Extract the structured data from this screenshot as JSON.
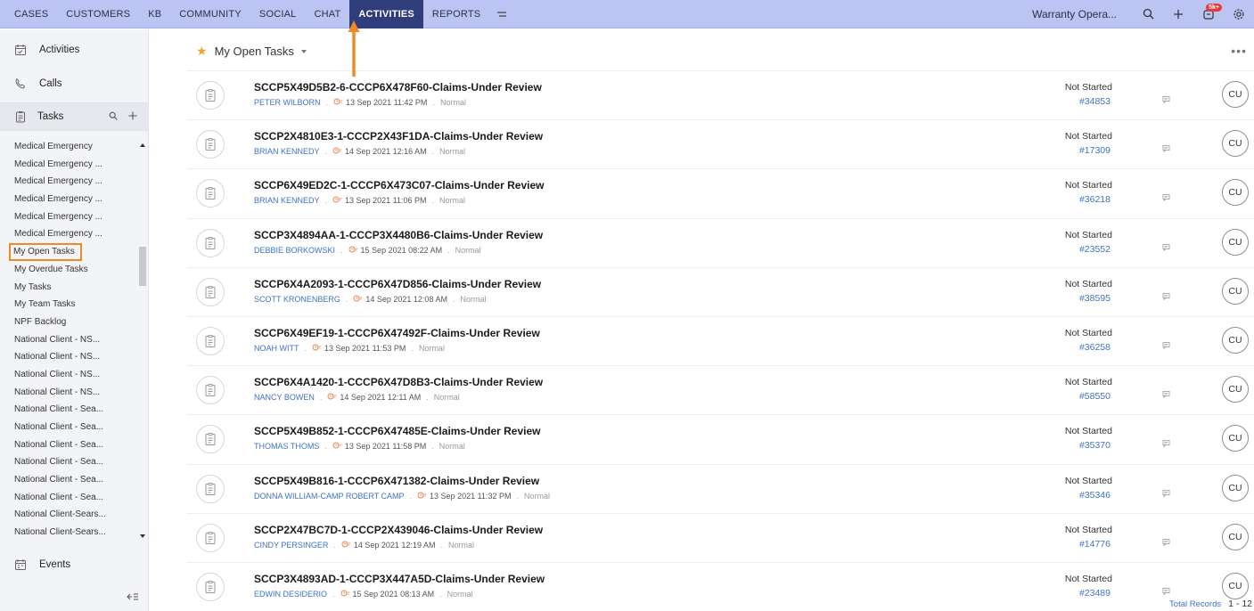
{
  "nav": {
    "items": [
      "CASES",
      "CUSTOMERS",
      "KB",
      "COMMUNITY",
      "SOCIAL",
      "CHAT",
      "ACTIVITIES",
      "REPORTS"
    ],
    "active": "ACTIVITIES",
    "department": "Warranty Opera...",
    "notification_badge": "5k+"
  },
  "sidebar": {
    "modules": {
      "activities": "Activities",
      "calls": "Calls",
      "tasks": "Tasks",
      "events": "Events"
    },
    "views": [
      "Medical Emergency",
      "Medical Emergency ...",
      "Medical Emergency ...",
      "Medical Emergency ...",
      "Medical Emergency ...",
      "Medical Emergency ...",
      "My Open Tasks",
      "My Overdue Tasks",
      "My Tasks",
      "My Team Tasks",
      "NPF Backlog",
      "National Client - NS...",
      "National Client - NS...",
      "National Client - NS...",
      "National Client - NS...",
      "National Client - Sea...",
      "National Client - Sea...",
      "National Client - Sea...",
      "National Client - Sea...",
      "National Client - Sea...",
      "National Client - Sea...",
      "National Client-Sears...",
      "National Client-Sears..."
    ],
    "selected_view": "My Open Tasks"
  },
  "main": {
    "view_title": "My Open Tasks",
    "rows": [
      {
        "subject": "SCCP5X49D5B2-6-CCCP6X478F60-Claims-Under Review",
        "contact": "PETER WILBORN",
        "due": "13 Sep 2021 11:42 PM",
        "priority": "Normal",
        "status": "Not Started",
        "ticket": "#34853",
        "owner": "CU"
      },
      {
        "subject": "SCCP2X4810E3-1-CCCP2X43F1DA-Claims-Under Review",
        "contact": "BRIAN KENNEDY",
        "due": "14 Sep 2021 12:16 AM",
        "priority": "Normal",
        "status": "Not Started",
        "ticket": "#17309",
        "owner": "CU"
      },
      {
        "subject": "SCCP6X49ED2C-1-CCCP6X473C07-Claims-Under Review",
        "contact": "BRIAN KENNEDY",
        "due": "13 Sep 2021 11:06 PM",
        "priority": "Normal",
        "status": "Not Started",
        "ticket": "#36218",
        "owner": "CU"
      },
      {
        "subject": "SCCP3X4894AA-1-CCCP3X4480B6-Claims-Under Review",
        "contact": "DEBBIE BORKOWSKI",
        "due": "15 Sep 2021 08:22 AM",
        "priority": "Normal",
        "status": "Not Started",
        "ticket": "#23552",
        "owner": "CU"
      },
      {
        "subject": "SCCP6X4A2093-1-CCCP6X47D856-Claims-Under Review",
        "contact": "SCOTT KRONENBERG",
        "due": "14 Sep 2021 12:08 AM",
        "priority": "Normal",
        "status": "Not Started",
        "ticket": "#38595",
        "owner": "CU"
      },
      {
        "subject": "SCCP6X49EF19-1-CCCP6X47492F-Claims-Under Review",
        "contact": "NOAH WITT",
        "due": "13 Sep 2021 11:53 PM",
        "priority": "Normal",
        "status": "Not Started",
        "ticket": "#36258",
        "owner": "CU"
      },
      {
        "subject": "SCCP6X4A1420-1-CCCP6X47D8B3-Claims-Under Review",
        "contact": "NANCY BOWEN",
        "due": "14 Sep 2021 12:11 AM",
        "priority": "Normal",
        "status": "Not Started",
        "ticket": "#58550",
        "owner": "CU"
      },
      {
        "subject": "SCCP5X49B852-1-CCCP6X47485E-Claims-Under Review",
        "contact": "THOMAS THOMS",
        "due": "13 Sep 2021 11:58 PM",
        "priority": "Normal",
        "status": "Not Started",
        "ticket": "#35370",
        "owner": "CU"
      },
      {
        "subject": "SCCP5X49B816-1-CCCP6X471382-Claims-Under Review",
        "contact": "DONNA WILLIAM-CAMP ROBERT CAMP",
        "due": "13 Sep 2021 11:32 PM",
        "priority": "Normal",
        "status": "Not Started",
        "ticket": "#35346",
        "owner": "CU"
      },
      {
        "subject": "SCCP2X47BC7D-1-CCCP2X439046-Claims-Under Review",
        "contact": "CINDY PERSINGER",
        "due": "14 Sep 2021 12:19 AM",
        "priority": "Normal",
        "status": "Not Started",
        "ticket": "#14776",
        "owner": "CU"
      },
      {
        "subject": "SCCP3X4893AD-1-CCCP3X447A5D-Claims-Under Review",
        "contact": "EDWIN DESIDERIO",
        "due": "15 Sep 2021 08:13 AM",
        "priority": "Normal",
        "status": "Not Started",
        "ticket": "#23489",
        "owner": "CU"
      }
    ],
    "footer": {
      "total_label": "Total Records",
      "page_from": "1",
      "page_sep": "-",
      "page_to": "12"
    }
  },
  "colors": {
    "nav_bg": "#bcc4f3",
    "nav_active": "#2f3d7a",
    "link": "#3f72c7",
    "highlight": "#f08a24",
    "star": "#f0a634"
  }
}
